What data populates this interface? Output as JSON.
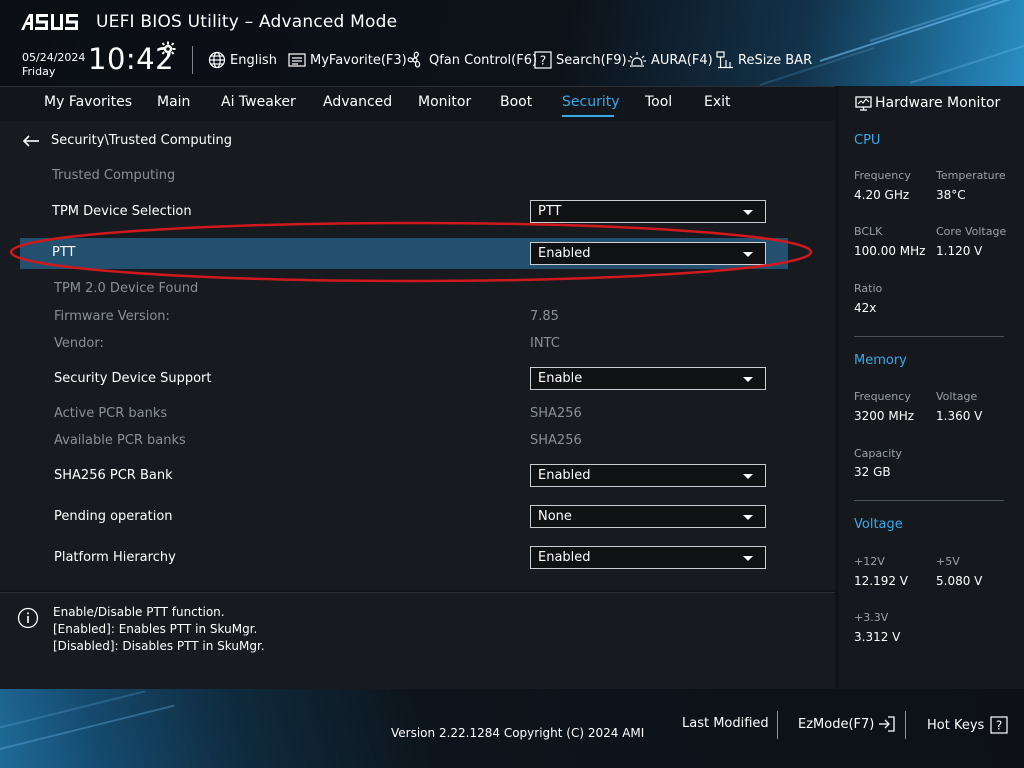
{
  "header": {
    "brand_logo": "ASUS",
    "title": "UEFI BIOS Utility – Advanced Mode",
    "date": "05/24/2024",
    "day": "Friday",
    "time": "10:42",
    "tools": [
      {
        "label": "English",
        "icon": "globe-icon"
      },
      {
        "label": "MyFavorite(F3)",
        "icon": "favorite-list-icon"
      },
      {
        "label": "Qfan Control(F6)",
        "icon": "fan-icon"
      },
      {
        "label": "Search(F9)",
        "icon": "search-help-icon"
      },
      {
        "label": "AURA(F4)",
        "icon": "aura-light-icon"
      },
      {
        "label": "ReSize BAR",
        "icon": "resize-bar-icon"
      }
    ]
  },
  "menu": {
    "tabs": [
      "My Favorites",
      "Main",
      "Ai Tweaker",
      "Advanced",
      "Monitor",
      "Boot",
      "Security",
      "Tool",
      "Exit"
    ],
    "active": "Security"
  },
  "main": {
    "breadcrumb": "Security\\Trusted Computing",
    "section_title": "Trusted Computing",
    "tpm_device_selection": {
      "label": "TPM Device Selection",
      "value": "PTT"
    },
    "ptt": {
      "label": "PTT",
      "value": "Enabled"
    },
    "tpm_found": "TPM 2.0 Device Found",
    "firmware_version": {
      "label": "Firmware Version:",
      "value": "7.85"
    },
    "vendor": {
      "label": "Vendor:",
      "value": "INTC"
    },
    "security_device_support": {
      "label": "Security Device Support",
      "value": "Enable"
    },
    "active_pcr_banks": {
      "label": "Active PCR banks",
      "value": "SHA256"
    },
    "available_pcr_banks": {
      "label": "Available PCR banks",
      "value": "SHA256"
    },
    "sha256_pcr_bank": {
      "label": "SHA256 PCR Bank",
      "value": "Enabled"
    },
    "pending_operation": {
      "label": "Pending operation",
      "value": "None"
    },
    "platform_hierarchy": {
      "label": "Platform Hierarchy",
      "value": "Enabled"
    }
  },
  "help": {
    "lines": [
      "Enable/Disable PTT function.",
      "[Enabled]: Enables PTT in SkuMgr.",
      "[Disabled]: Disables PTT in SkuMgr."
    ]
  },
  "hardware_monitor": {
    "title": "Hardware Monitor",
    "cpu": {
      "heading": "CPU",
      "frequency": {
        "label": "Frequency",
        "value": "4.20 GHz"
      },
      "temperature": {
        "label": "Temperature",
        "value": "38°C"
      },
      "bclk": {
        "label": "BCLK",
        "value": "100.00 MHz"
      },
      "core_voltage": {
        "label": "Core Voltage",
        "value": "1.120 V"
      },
      "ratio": {
        "label": "Ratio",
        "value": "42x"
      }
    },
    "memory": {
      "heading": "Memory",
      "frequency": {
        "label": "Frequency",
        "value": "3200 MHz"
      },
      "voltage": {
        "label": "Voltage",
        "value": "1.360 V"
      },
      "capacity": {
        "label": "Capacity",
        "value": "32 GB"
      }
    },
    "voltage": {
      "heading": "Voltage",
      "v12": {
        "label": "+12V",
        "value": "12.192 V"
      },
      "v5": {
        "label": "+5V",
        "value": "5.080 V"
      },
      "v33": {
        "label": "+3.3V",
        "value": "3.312 V"
      }
    }
  },
  "footer": {
    "version": "Version 2.22.1284 Copyright (C) 2024 AMI",
    "last_modified": "Last Modified",
    "ezmode": "EzMode(F7)",
    "hotkeys": "Hot Keys"
  },
  "colors": {
    "accent": "#3aa8e8",
    "highlight_row": "#23506e",
    "annotation_ellipse": "#d0191c"
  }
}
